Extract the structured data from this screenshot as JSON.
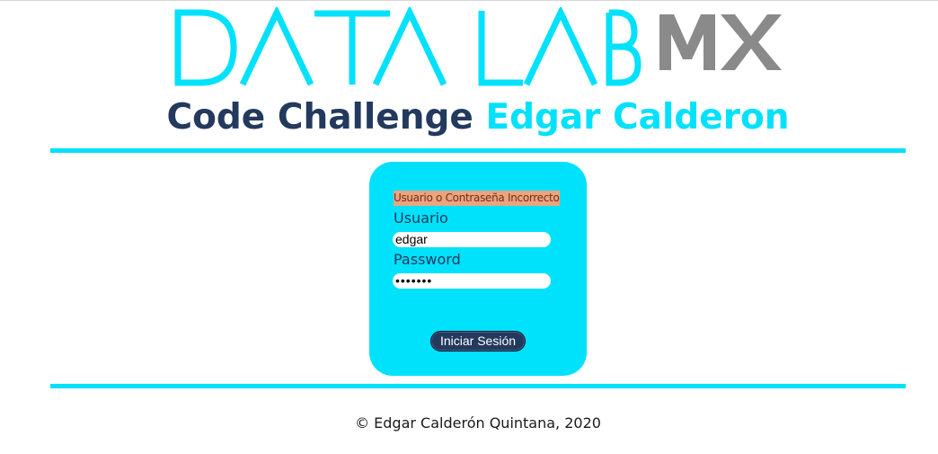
{
  "logo": {
    "primary_text": "DATA LAB",
    "suffix_text": "MX",
    "primary_color": "#00e1fc",
    "suffix_color": "#8a8a8a"
  },
  "heading": {
    "part1": "Code Challenge",
    "part2": "Edgar Calderon",
    "part1_color": "#23395d",
    "part2_color": "#00e1fc"
  },
  "login": {
    "error_message": "Usuario o Contraseña Incorrecto",
    "username_label": "Usuario",
    "username_value": "edgar",
    "password_label": "Password",
    "password_value": "•••••••",
    "submit_label": "Iniciar Sesión",
    "card_color": "#00e1fc",
    "error_bg_color": "#e8a57f",
    "button_color": "#23395d"
  },
  "footer": {
    "copyright": "© Edgar Calderón Quintana, 2020"
  }
}
